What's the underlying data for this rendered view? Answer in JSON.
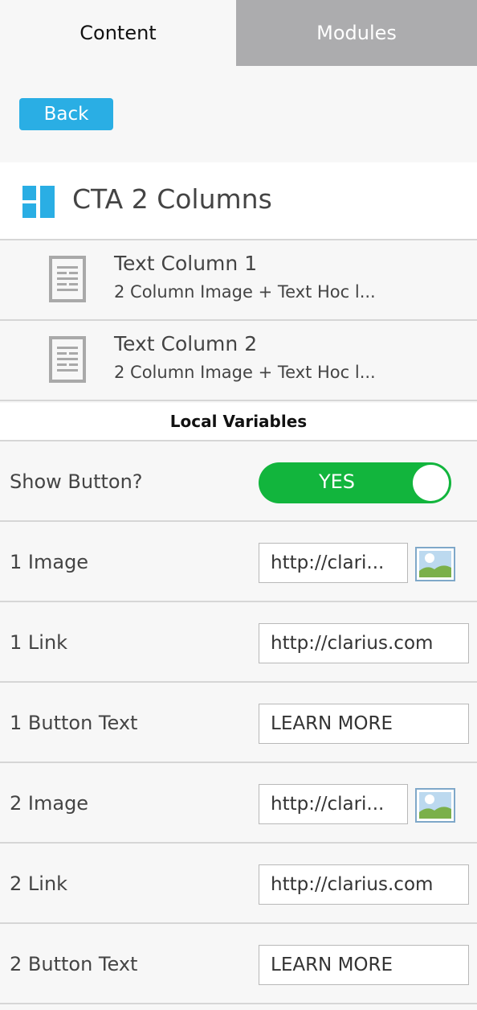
{
  "tabs": [
    {
      "label": "Content"
    },
    {
      "label": "Modules"
    }
  ],
  "back_label": "Back",
  "module": {
    "title": "CTA 2 Columns",
    "icon": "two-column-layout-icon"
  },
  "columns": [
    {
      "title": "Text Column 1",
      "subtitle": "2 Column Image + Text Hoc l..."
    },
    {
      "title": "Text Column 2",
      "subtitle": "2 Column Image + Text Hoc l..."
    }
  ],
  "local_variables": {
    "heading": "Local Variables",
    "show_button": {
      "label": "Show Button?",
      "value": "YES"
    },
    "image1": {
      "label": "1 Image",
      "value": "http://clari..."
    },
    "link1": {
      "label": "1 Link",
      "value": "http://clarius.com"
    },
    "button_text1": {
      "label": "1 Button Text",
      "value": "LEARN MORE"
    },
    "image2": {
      "label": "2 Image",
      "value": "http://clari..."
    },
    "link2": {
      "label": "2 Link",
      "value": "http://clarius.com"
    },
    "button_text2": {
      "label": "2 Button Text",
      "value": "LEARN MORE"
    }
  },
  "colors": {
    "accent": "#2aaee4",
    "toggle_on": "#12b53d",
    "inactive_tab": "#acacae"
  }
}
